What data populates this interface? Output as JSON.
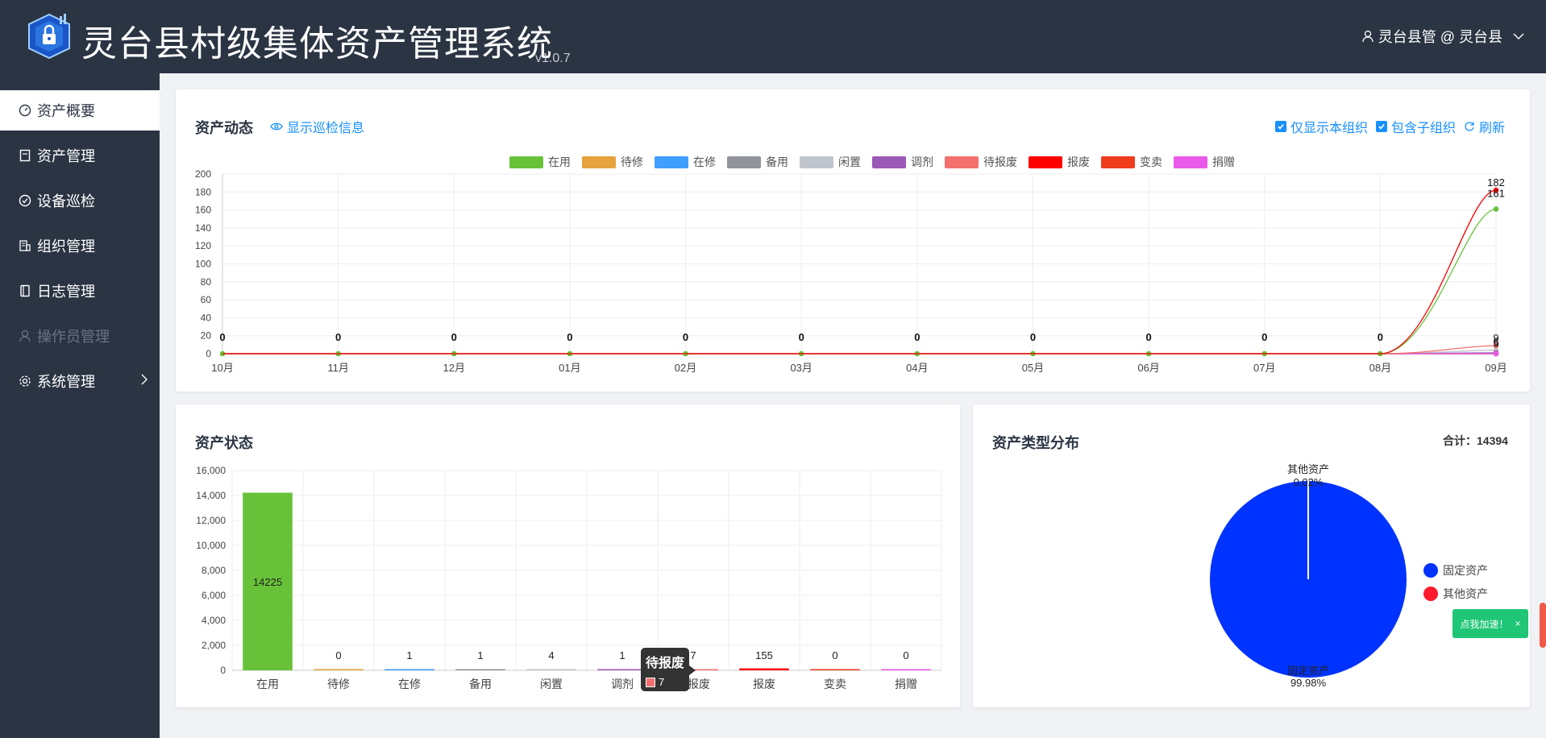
{
  "header": {
    "title": "灵台县村级集体资产管理系统",
    "version": "v1.0.7",
    "user": "灵台县管 @ 灵台县"
  },
  "sidebar": {
    "items": [
      {
        "label": "资产概要",
        "icon": "dashboard-icon",
        "state": "active"
      },
      {
        "label": "资产管理",
        "icon": "document-icon",
        "state": "normal"
      },
      {
        "label": "设备巡检",
        "icon": "check-circle-icon",
        "state": "normal"
      },
      {
        "label": "组织管理",
        "icon": "building-icon",
        "state": "normal"
      },
      {
        "label": "日志管理",
        "icon": "book-icon",
        "state": "normal"
      },
      {
        "label": "操作员管理",
        "icon": "user-icon",
        "state": "disabled"
      },
      {
        "label": "系统管理",
        "icon": "gear-icon",
        "state": "normal",
        "has_submenu": true
      }
    ]
  },
  "dynamics": {
    "title": "资产动态",
    "show_inspection": "显示巡检信息",
    "only_this_org": "仅显示本组织",
    "include_sub_org": "包含子组织",
    "refresh": "刷新"
  },
  "status": {
    "title": "资产状态"
  },
  "type_dist": {
    "title": "资产类型分布",
    "total_label": "合计：14394"
  },
  "tooltip": {
    "title": "待报废",
    "value": "7"
  },
  "floating": {
    "speed_button": "点我加速！",
    "close": "×"
  },
  "colors": {
    "header_bg": "#2b3443",
    "accent": "#1890ff",
    "在用": "#67c23a",
    "待修": "#e6a23c",
    "在修": "#409eff",
    "备用": "#909399",
    "闲置": "#c0c4cc",
    "调剂": "#9b59b6",
    "待报废": "#f3706f",
    "报废": "#ff0000",
    "变卖": "#f03c1e",
    "捐赠": "#e95ae8",
    "固定资产": "#0033ff",
    "其他资产": "#ff1a2e"
  },
  "chart_data": [
    {
      "type": "line",
      "title": "资产动态",
      "x": [
        "10月",
        "11月",
        "12月",
        "01月",
        "02月",
        "03月",
        "04月",
        "05月",
        "06月",
        "07月",
        "08月",
        "09月"
      ],
      "ylim": [
        0,
        200
      ],
      "yticks": [
        0,
        20,
        40,
        60,
        80,
        100,
        120,
        140,
        160,
        180,
        200
      ],
      "grid": true,
      "legend_position": "top",
      "series": [
        {
          "name": "在用",
          "values": [
            0,
            0,
            0,
            0,
            0,
            0,
            0,
            0,
            0,
            0,
            0,
            161
          ]
        },
        {
          "name": "待修",
          "values": [
            0,
            0,
            0,
            0,
            0,
            0,
            0,
            0,
            0,
            0,
            0,
            0
          ]
        },
        {
          "name": "在修",
          "values": [
            0,
            0,
            0,
            0,
            0,
            0,
            0,
            0,
            0,
            0,
            0,
            0
          ]
        },
        {
          "name": "备用",
          "values": [
            0,
            0,
            0,
            0,
            0,
            0,
            0,
            0,
            0,
            0,
            0,
            0
          ]
        },
        {
          "name": "闲置",
          "values": [
            0,
            0,
            0,
            0,
            0,
            0,
            0,
            0,
            0,
            0,
            0,
            4
          ]
        },
        {
          "name": "调剂",
          "values": [
            0,
            0,
            0,
            0,
            0,
            0,
            0,
            0,
            0,
            0,
            0,
            1
          ]
        },
        {
          "name": "待报废",
          "values": [
            0,
            0,
            0,
            0,
            0,
            0,
            0,
            0,
            0,
            0,
            0,
            9
          ]
        },
        {
          "name": "报废",
          "values": [
            0,
            0,
            0,
            0,
            0,
            0,
            0,
            0,
            0,
            0,
            0,
            182
          ]
        },
        {
          "name": "变卖",
          "values": [
            0,
            0,
            0,
            0,
            0,
            0,
            0,
            0,
            0,
            0,
            0,
            0
          ]
        },
        {
          "name": "捐赠",
          "values": [
            0,
            0,
            0,
            0,
            0,
            0,
            0,
            0,
            0,
            0,
            0,
            0
          ]
        }
      ],
      "point_labels": [
        "0",
        "0",
        "0",
        "0",
        "0",
        "0",
        "0",
        "0",
        "0",
        "0",
        "0"
      ],
      "end_labels": [
        "182",
        "161",
        "9",
        "6",
        "5"
      ]
    },
    {
      "type": "bar",
      "title": "资产状态",
      "categories": [
        "在用",
        "待修",
        "在修",
        "备用",
        "闲置",
        "调剂",
        "待报废",
        "报废",
        "变卖",
        "捐赠"
      ],
      "values": [
        14225,
        0,
        1,
        1,
        4,
        1,
        7,
        155,
        0,
        0
      ],
      "labels": [
        "14225",
        "0",
        "1",
        "1",
        "4",
        "1",
        "7",
        "155",
        "0",
        "0"
      ],
      "ylim": [
        0,
        16000
      ],
      "yticks": [
        "0",
        "2,000",
        "4,000",
        "6,000",
        "8,000",
        "10,000",
        "12,000",
        "14,000",
        "16,000"
      ],
      "grid": true
    },
    {
      "type": "pie",
      "title": "资产类型分布",
      "slices": [
        {
          "name": "固定资产",
          "percent": 99.98,
          "label": "99.98%"
        },
        {
          "name": "其他资产",
          "percent": 0.02,
          "label": "0.02%"
        }
      ],
      "legend_position": "right"
    }
  ]
}
